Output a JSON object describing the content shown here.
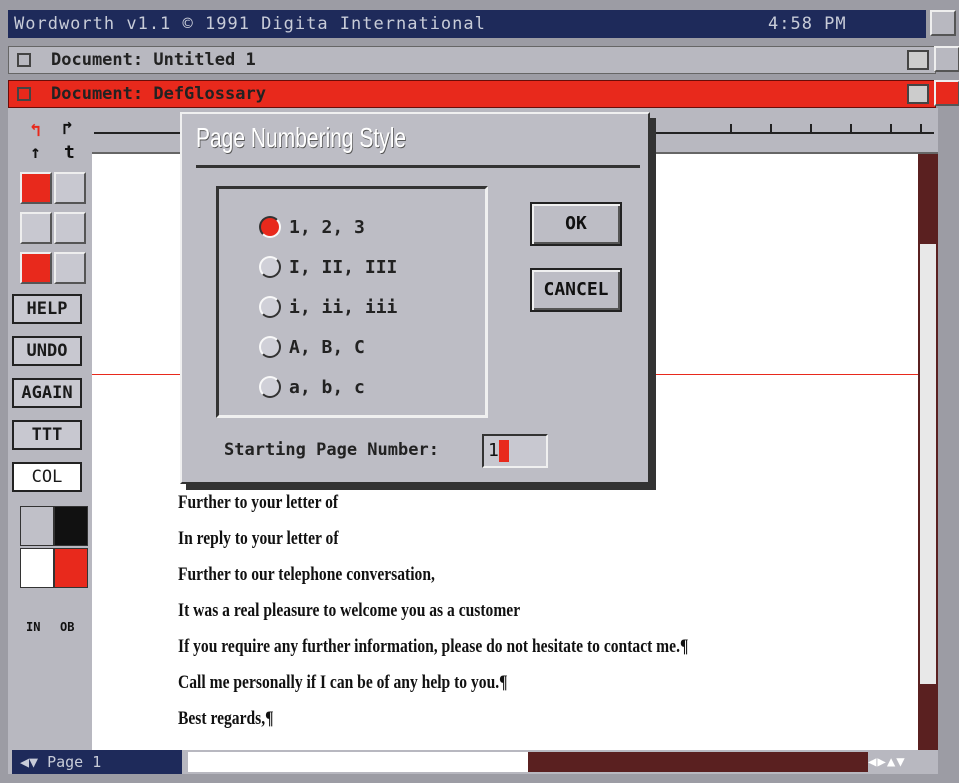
{
  "screen": {
    "title": "Wordworth v1.1 © 1991 Digita International",
    "clock": "4:58 PM"
  },
  "windows": {
    "inactive_title": "Document: Untitled 1",
    "active_title": "Document: DefGlossary"
  },
  "toolbox": {
    "help": "HELP",
    "undo": "UNDO",
    "again": "AGAIN",
    "styles": "TTT",
    "col": "COL",
    "small_left": "IN",
    "small_right": "OB"
  },
  "dialog": {
    "title": "Page Numbering Style",
    "options": [
      {
        "label": "1, 2, 3",
        "selected": true
      },
      {
        "label": "I, II, III",
        "selected": false
      },
      {
        "label": "i, ii, iii",
        "selected": false
      },
      {
        "label": "A, B, C",
        "selected": false
      },
      {
        "label": "a, b, c",
        "selected": false
      }
    ],
    "ok": "OK",
    "cancel": "CANCEL",
    "start_label": "Starting Page Number:",
    "start_value": "1"
  },
  "document": {
    "lines": [
      "Further to your letter of",
      "In reply to your letter of",
      "Further to our telephone conversation,",
      "It was a real pleasure to welcome you as a customer",
      "If you require any further information, please do not hesitate to contact me.¶",
      "Call me personally if I can be of any help to you.¶",
      "Best regards,¶"
    ]
  },
  "status": {
    "page": "Page 1"
  },
  "colors": {
    "accent": "#e8291c",
    "titlebar": "#1e2a5a",
    "panel": "#bdbdc5"
  }
}
